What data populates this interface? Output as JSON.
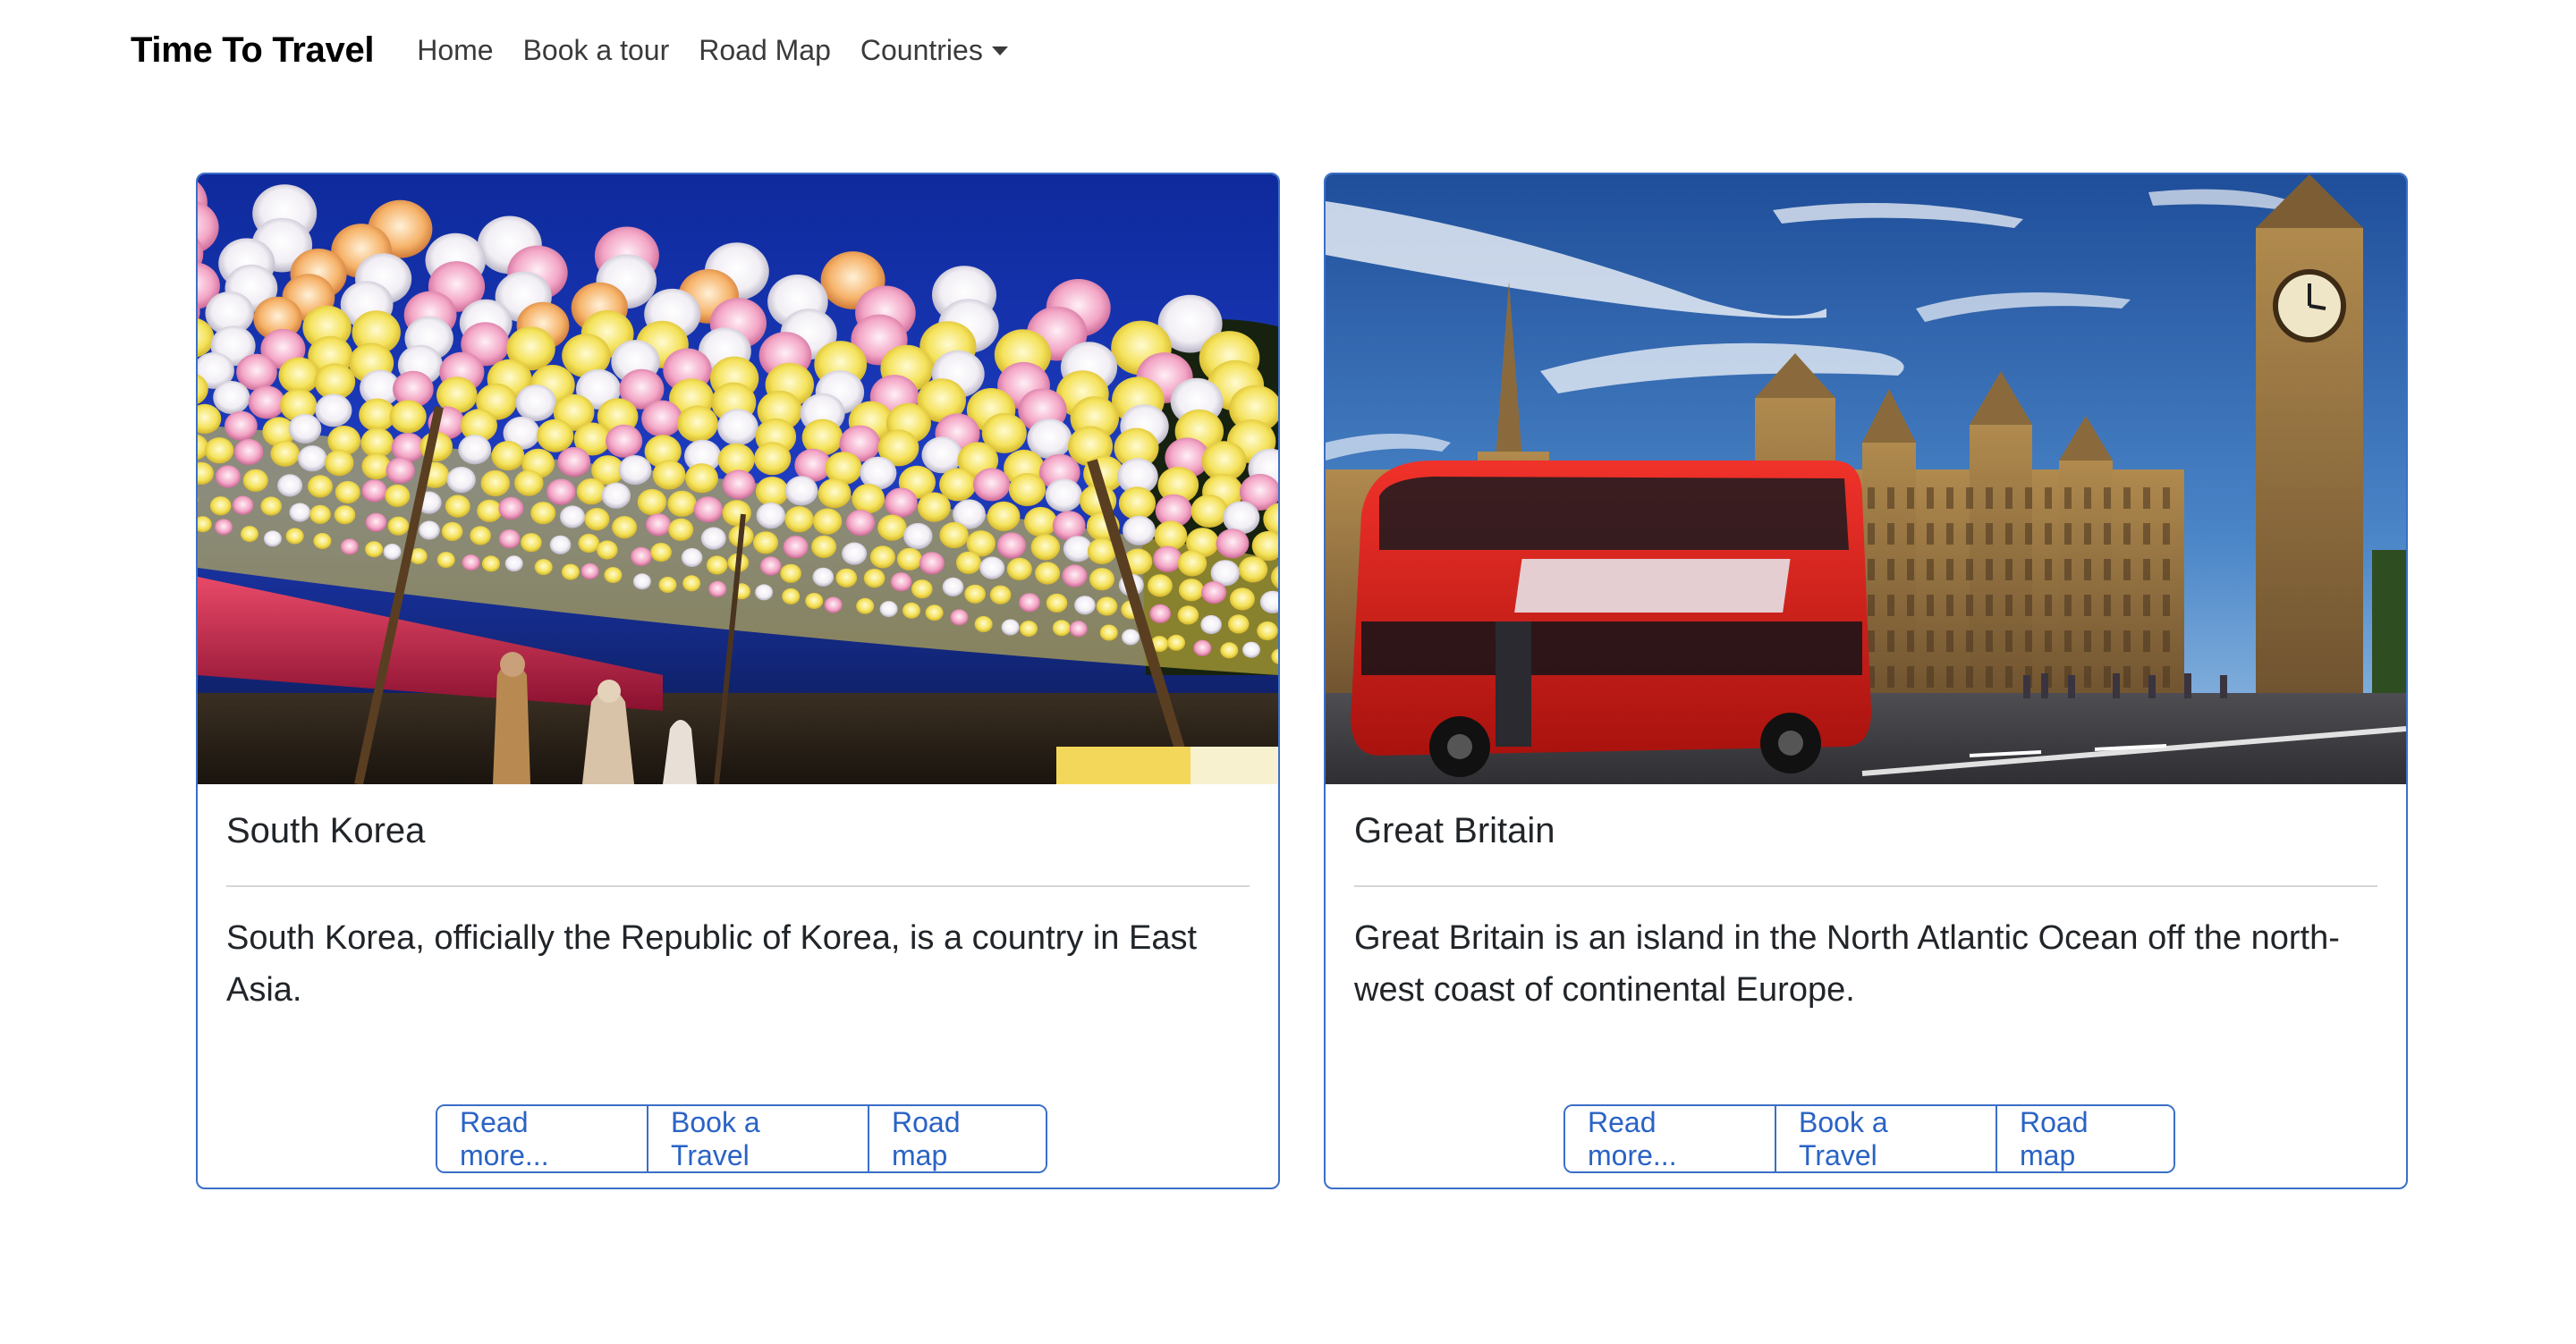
{
  "navbar": {
    "brand": "Time To Travel",
    "links": [
      "Home",
      "Book a tour",
      "Road Map",
      "Countries"
    ]
  },
  "cards": [
    {
      "title": "South Korea",
      "text": "South Korea, officially the Republic of Korea, is a country in East Asia.",
      "image": "lantern-festival-photo",
      "buttons": [
        "Read more...",
        "Book a Travel",
        "Road map"
      ]
    },
    {
      "title": "Great Britain",
      "text": "Great Britain is an island in the North Atlantic Ocean off the north-west coast of continental Europe.",
      "image": "london-bus-big-ben-photo",
      "buttons": [
        "Read more...",
        "Book a Travel",
        "Road map"
      ]
    }
  ],
  "colors": {
    "accent": "#2a63c5",
    "card_border": "#3b6fc7",
    "text": "#212529"
  }
}
